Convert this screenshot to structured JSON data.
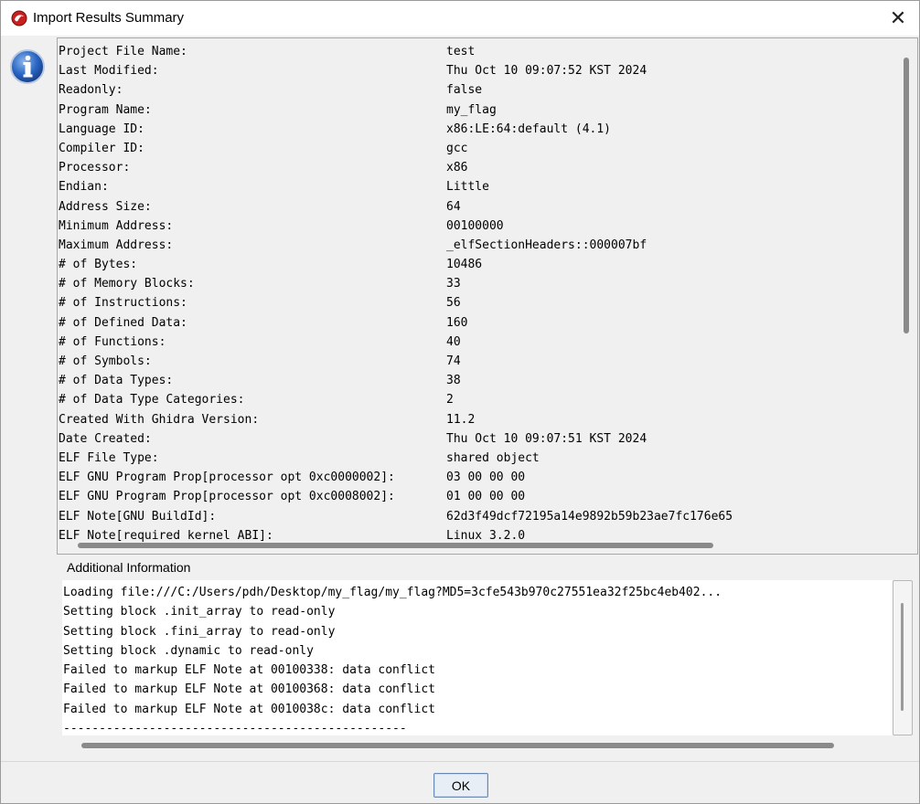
{
  "window": {
    "title": "Import Results Summary",
    "close": "✕"
  },
  "summary": {
    "rows": [
      {
        "key": "Project File Name:",
        "value": "test"
      },
      {
        "key": "Last Modified:",
        "value": "Thu Oct 10 09:07:52 KST 2024"
      },
      {
        "key": "Readonly:",
        "value": "false"
      },
      {
        "key": "Program Name:",
        "value": "my_flag"
      },
      {
        "key": "Language ID:",
        "value": "x86:LE:64:default (4.1)"
      },
      {
        "key": "Compiler ID:",
        "value": "gcc"
      },
      {
        "key": "Processor:",
        "value": "x86"
      },
      {
        "key": "Endian:",
        "value": "Little"
      },
      {
        "key": "Address Size:",
        "value": "64"
      },
      {
        "key": "Minimum Address:",
        "value": "00100000"
      },
      {
        "key": "Maximum Address:",
        "value": "_elfSectionHeaders::000007bf"
      },
      {
        "key": "# of Bytes:",
        "value": "10486"
      },
      {
        "key": "# of Memory Blocks:",
        "value": "33"
      },
      {
        "key": "# of Instructions:",
        "value": "56"
      },
      {
        "key": "# of Defined Data:",
        "value": "160"
      },
      {
        "key": "# of Functions:",
        "value": "40"
      },
      {
        "key": "# of Symbols:",
        "value": "74"
      },
      {
        "key": "# of Data Types:",
        "value": "38"
      },
      {
        "key": "# of Data Type Categories:",
        "value": "2"
      },
      {
        "key": "Created With Ghidra Version:",
        "value": "11.2"
      },
      {
        "key": "Date Created:",
        "value": "Thu Oct 10 09:07:51 KST 2024"
      },
      {
        "key": "ELF File Type:",
        "value": "shared object"
      },
      {
        "key": "ELF GNU Program Prop[processor opt 0xc0000002]:",
        "value": "03 00 00 00"
      },
      {
        "key": "ELF GNU Program Prop[processor opt 0xc0008002]:",
        "value": "01 00 00 00"
      },
      {
        "key": "ELF Note[GNU BuildId]:",
        "value": "62d3f49dcf72195a14e9892b59b23ae7fc176e65"
      },
      {
        "key": "ELF Note[required kernel ABI]:",
        "value": "Linux 3.2.0"
      }
    ]
  },
  "additional": {
    "label": "Additional Information",
    "lines": [
      "Loading file:///C:/Users/pdh/Desktop/my_flag/my_flag?MD5=3cfe543b970c27551ea32f25bc4eb402...",
      "Setting block .init_array to read-only",
      "Setting block .fini_array to read-only",
      "Setting block .dynamic to read-only",
      "Failed to markup ELF Note at 00100338: data conflict",
      "Failed to markup ELF Note at 00100368: data conflict",
      "Failed to markup ELF Note at 0010038c: data conflict",
      "------------------------------------------------"
    ]
  },
  "buttons": {
    "ok": "OK"
  }
}
